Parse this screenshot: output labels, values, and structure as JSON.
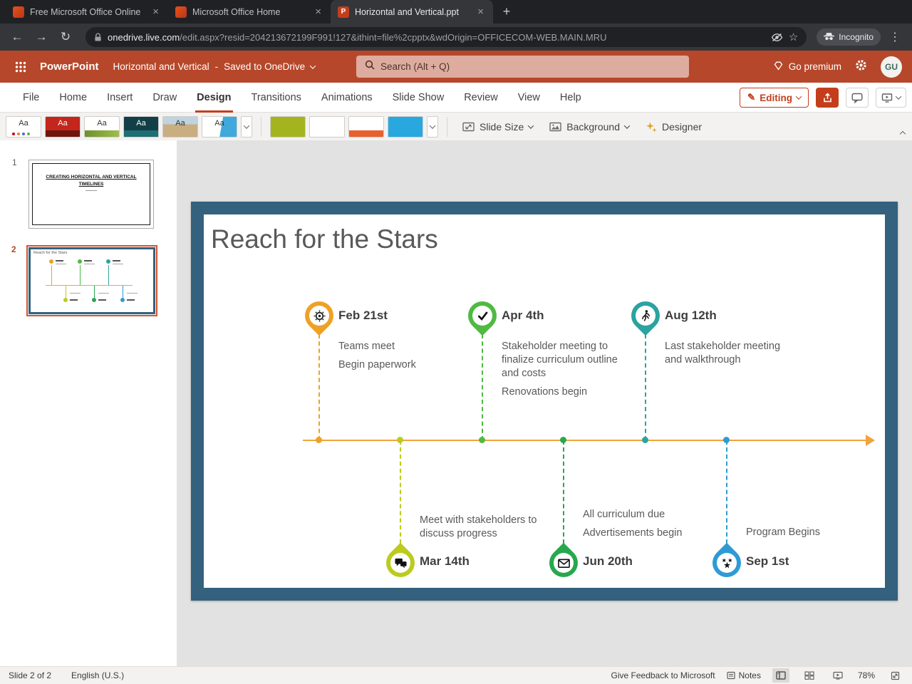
{
  "browser": {
    "tabs": [
      {
        "title": "Free Microsoft Office Online",
        "icon": "office-icon"
      },
      {
        "title": "Microsoft Office Home",
        "icon": "office-icon"
      },
      {
        "title": "Horizontal and Vertical.ppt",
        "icon": "powerpoint-icon"
      }
    ],
    "url_host": "onedrive.live.com",
    "url_rest": "/edit.aspx?resid=204213672199F991!127&ithint=file%2cpptx&wdOrigin=OFFICECOM-WEB.MAIN.MRU",
    "incognito_label": "Incognito"
  },
  "header": {
    "app_name": "PowerPoint",
    "doc_title": "Horizontal and Vertical",
    "title_separator": "-",
    "saved_status": "Saved to OneDrive",
    "search_placeholder": "Search (Alt + Q)",
    "premium_label": "Go premium",
    "avatar_initials": "GU",
    "brand_color": "#B7472A"
  },
  "ribbon": {
    "tabs": [
      "File",
      "Home",
      "Insert",
      "Draw",
      "Design",
      "Transitions",
      "Animations",
      "Slide Show",
      "Review",
      "View",
      "Help"
    ],
    "active_tab": "Design",
    "editing_label": "Editing",
    "theme_sample": "Aa",
    "slide_size_label": "Slide Size",
    "background_label": "Background",
    "designer_label": "Designer"
  },
  "slide_panel": {
    "slides": [
      {
        "number": "1",
        "title": "CREATING HORIZONTAL AND VERTICAL TIMELINES"
      },
      {
        "number": "2",
        "title": "Reach for the Stars"
      }
    ],
    "selected_slide": 2
  },
  "slide": {
    "title": "Reach for the Stars",
    "frame_color": "#33617E",
    "timeline_color": "#F2A33C",
    "milestones_top": [
      {
        "date": "Feb 21st",
        "lines": [
          "Teams meet",
          "Begin paperwork"
        ],
        "color": "#EFA126",
        "icon": "award-icon"
      },
      {
        "date": "Apr 4th",
        "lines": [
          "Stakeholder meeting to finalize curriculum outline and costs",
          "Renovations begin"
        ],
        "color": "#4FBA41",
        "icon": "checkmark-icon"
      },
      {
        "date": "Aug 12th",
        "lines": [
          "Last stakeholder meeting and walkthrough"
        ],
        "color": "#2BA3A0",
        "icon": "walking-person-icon"
      }
    ],
    "milestones_bottom": [
      {
        "date": "Mar 14th",
        "lines": [
          "Meet with stakeholders to discuss progress"
        ],
        "color": "#BCCB1E",
        "icon": "chat-icon"
      },
      {
        "date": "Jun 20th",
        "lines": [
          "All curriculum due",
          "Advertisements begin"
        ],
        "color": "#27A84E",
        "icon": "mail-icon"
      },
      {
        "date": "Sep 1st",
        "lines": [
          "Program Begins"
        ],
        "color": "#2E9BD5",
        "icon": "stars-icon"
      }
    ]
  },
  "status_bar": {
    "slide_info": "Slide 2 of 2",
    "language": "English (U.S.)",
    "feedback": "Give Feedback to Microsoft",
    "notes_label": "Notes",
    "zoom_level": "78%"
  }
}
